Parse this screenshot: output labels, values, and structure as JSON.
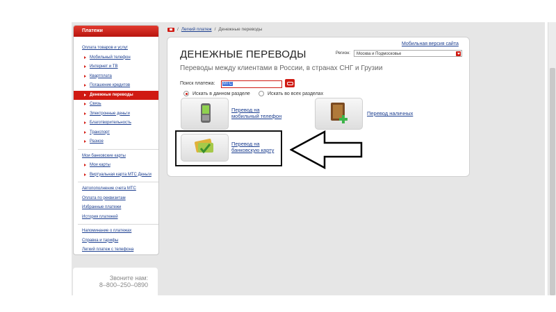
{
  "sidebar": {
    "header": "Платежи",
    "groups": [
      {
        "title": "Оплата товаров и услуг",
        "items": [
          "Мобильный телефон",
          "Интернет и ТВ",
          "Квартплата",
          "Погашение кредитов",
          "Денежные переводы",
          "Связь",
          "Электронные деньги",
          "Благотворительность",
          "Транспорт",
          "Разное"
        ]
      },
      {
        "title": "Мои банковские карты",
        "items": [
          "Мои карты",
          "Виртуальная карта МТС Деньги"
        ]
      }
    ],
    "links": [
      "Автопополнение счета МТС",
      "Оплата по реквизитам",
      "Избранные платежи",
      "История платежей"
    ],
    "links2": [
      "Напоминание о платежах",
      "Справка и тарифы",
      "Легкий платеж с телефона"
    ]
  },
  "callbox": {
    "line1": "Звоните нам:",
    "line2": "8–800–250–0890"
  },
  "breadcrumb": {
    "link": "Легкий платеж",
    "current": "Денежные переводы",
    "sep": "/"
  },
  "header": {
    "mobile_link": "Мобильная версия сайта",
    "title": "ДЕНЕЖНЫЕ ПЕРЕВОДЫ",
    "region_label": "Регион:",
    "region_value": "Москва и Подмосковье"
  },
  "main": {
    "subtitle": "Переводы между клиентами в России, в странах СНГ и Грузии",
    "search_label": "Поиск платежа:",
    "search_value": "МТС",
    "radio1": "Искать в данном разделе",
    "radio2": "Искать во всех разделах",
    "tiles": [
      {
        "line1": "Перевод на",
        "line2": "мобильный телефон",
        "icon": "mobile-phone-icon"
      },
      {
        "line1": "Перевод наличных",
        "line2": "",
        "icon": "wallet-icon"
      },
      {
        "line1": "Перевод на",
        "line2": "банковскую карту",
        "icon": "bank-card-icon"
      }
    ]
  },
  "colors": {
    "accent": "#d01a12",
    "link": "#1a3d8f"
  }
}
